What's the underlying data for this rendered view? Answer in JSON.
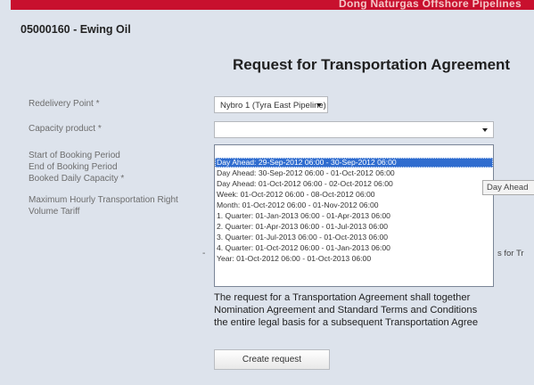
{
  "header": {
    "brand": "Dong Naturgas  Offshore Pipelines",
    "account": "05000160  -  Ewing Oil"
  },
  "page": {
    "title": "Request for Transportation Agreement"
  },
  "form": {
    "labels": {
      "redelivery_point": "Redelivery Point *",
      "capacity_product": "Capacity product *",
      "start_booking": "Start of Booking Period",
      "end_booking": "End of Booking Period",
      "booked_daily": "Booked Daily Capacity *",
      "max_hourly": "Maximum Hourly Transportation Right",
      "volume_tariff": "Volume Tariff"
    },
    "redelivery_value": "Nybro 1 (Tyra East Pipeline)",
    "capacity_value": ""
  },
  "dropdown": {
    "options": [
      "",
      "Day Ahead: 29-Sep-2012 06:00 - 30-Sep-2012 06:00",
      "Day Ahead: 30-Sep-2012 06:00 - 01-Oct-2012 06:00",
      "Day Ahead: 01-Oct-2012 06:00 - 02-Oct-2012 06:00",
      "Week: 01-Oct-2012 06:00 - 08-Oct-2012 06:00",
      "Month: 01-Oct-2012 06:00 - 01-Nov-2012 06:00",
      "1. Quarter: 01-Jan-2013 06:00 - 01-Apr-2013 06:00",
      "2. Quarter: 01-Apr-2013 06:00 - 01-Jul-2013 06:00",
      "3. Quarter: 01-Jul-2013 06:00 - 01-Oct-2013 06:00",
      "4. Quarter: 01-Oct-2012 06:00 - 01-Jan-2013 06:00",
      "Year: 01-Oct-2012 06:00 - 01-Oct-2013 06:00"
    ]
  },
  "tooltip": "Day Ahead",
  "background_text": "s for Tr",
  "dash": "-",
  "notice": {
    "line1": "The request for a Transportation Agreement shall together",
    "line2": "Nomination Agreement and Standard Terms and Conditions",
    "line3": "the entire legal basis for a subsequent Transportation Agree"
  },
  "buttons": {
    "create": "Create request"
  }
}
